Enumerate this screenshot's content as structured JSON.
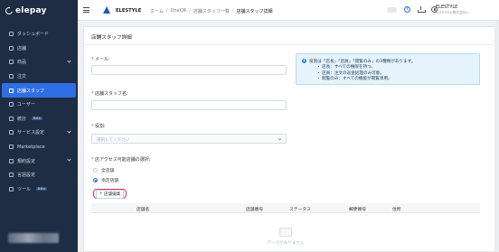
{
  "sidebar": {
    "logo": "elepay",
    "items": [
      {
        "label": "ダッシュボード",
        "icon": "dashboard-icon"
      },
      {
        "label": "店舗",
        "icon": "store-icon"
      },
      {
        "label": "商品",
        "icon": "product-icon",
        "expandable": true
      },
      {
        "label": "注文",
        "icon": "order-icon"
      },
      {
        "label": "店舗スタッフ",
        "icon": "staff-icon",
        "active": true
      },
      {
        "label": "ユーザー",
        "icon": "user-icon"
      },
      {
        "label": "統計",
        "icon": "stats-icon",
        "badge": "Beta"
      },
      {
        "label": "サービス設定",
        "icon": "service-icon",
        "expandable": true
      },
      {
        "label": "Marketplace",
        "icon": "marketplace-icon"
      },
      {
        "label": "規約設定",
        "icon": "terms-icon",
        "expandable": true
      },
      {
        "label": "言語設定",
        "icon": "language-icon"
      },
      {
        "label": "ツール",
        "icon": "tool-icon",
        "badge": "Beta"
      }
    ]
  },
  "topbar": {
    "brand": "ELESTYLE",
    "breadcrumbs": [
      "ホーム",
      "OneQR",
      "店舗スタッフ一覧",
      "店舗スタッフ詳細"
    ],
    "user_name": "ELESTYLE",
    "user_company": "ELESTYLE株式会社(...",
    "help_label": "?"
  },
  "page": {
    "title": "店舗スタッフ詳細",
    "email_label": "メール:",
    "name_label": "店舗スタッフ名:",
    "role_label": "役割:",
    "role_placeholder": "選択してください",
    "access_label": "店アクセス可能店舗の選択:",
    "radio_all": "全店舗",
    "radio_specified": "指定店舗",
    "radio_selected": "指定店舗",
    "store_edit_button": "店舗編集",
    "store_edit_prefix": "+",
    "table_headers": [
      "店舗名",
      "店舗番号",
      "ステータス",
      "郵便番号",
      "住所"
    ],
    "empty_text": "データがありません",
    "info": {
      "main": "役割は「店長」「店員」「閲覧のみ」の3種類があります。",
      "lines": [
        "・ 店長：すべての権限を持つ。",
        "・ 店員：注文の返金処理のみ可能。",
        "・ 閲覧のみ：すべての機能が閲覧専用。"
      ]
    }
  },
  "colors": {
    "sidebar_bg": "#1f2d44",
    "accent": "#2f6fe4",
    "highlight": "#d6336c",
    "required": "#e0304a",
    "info_bg": "#e6f3fc"
  }
}
